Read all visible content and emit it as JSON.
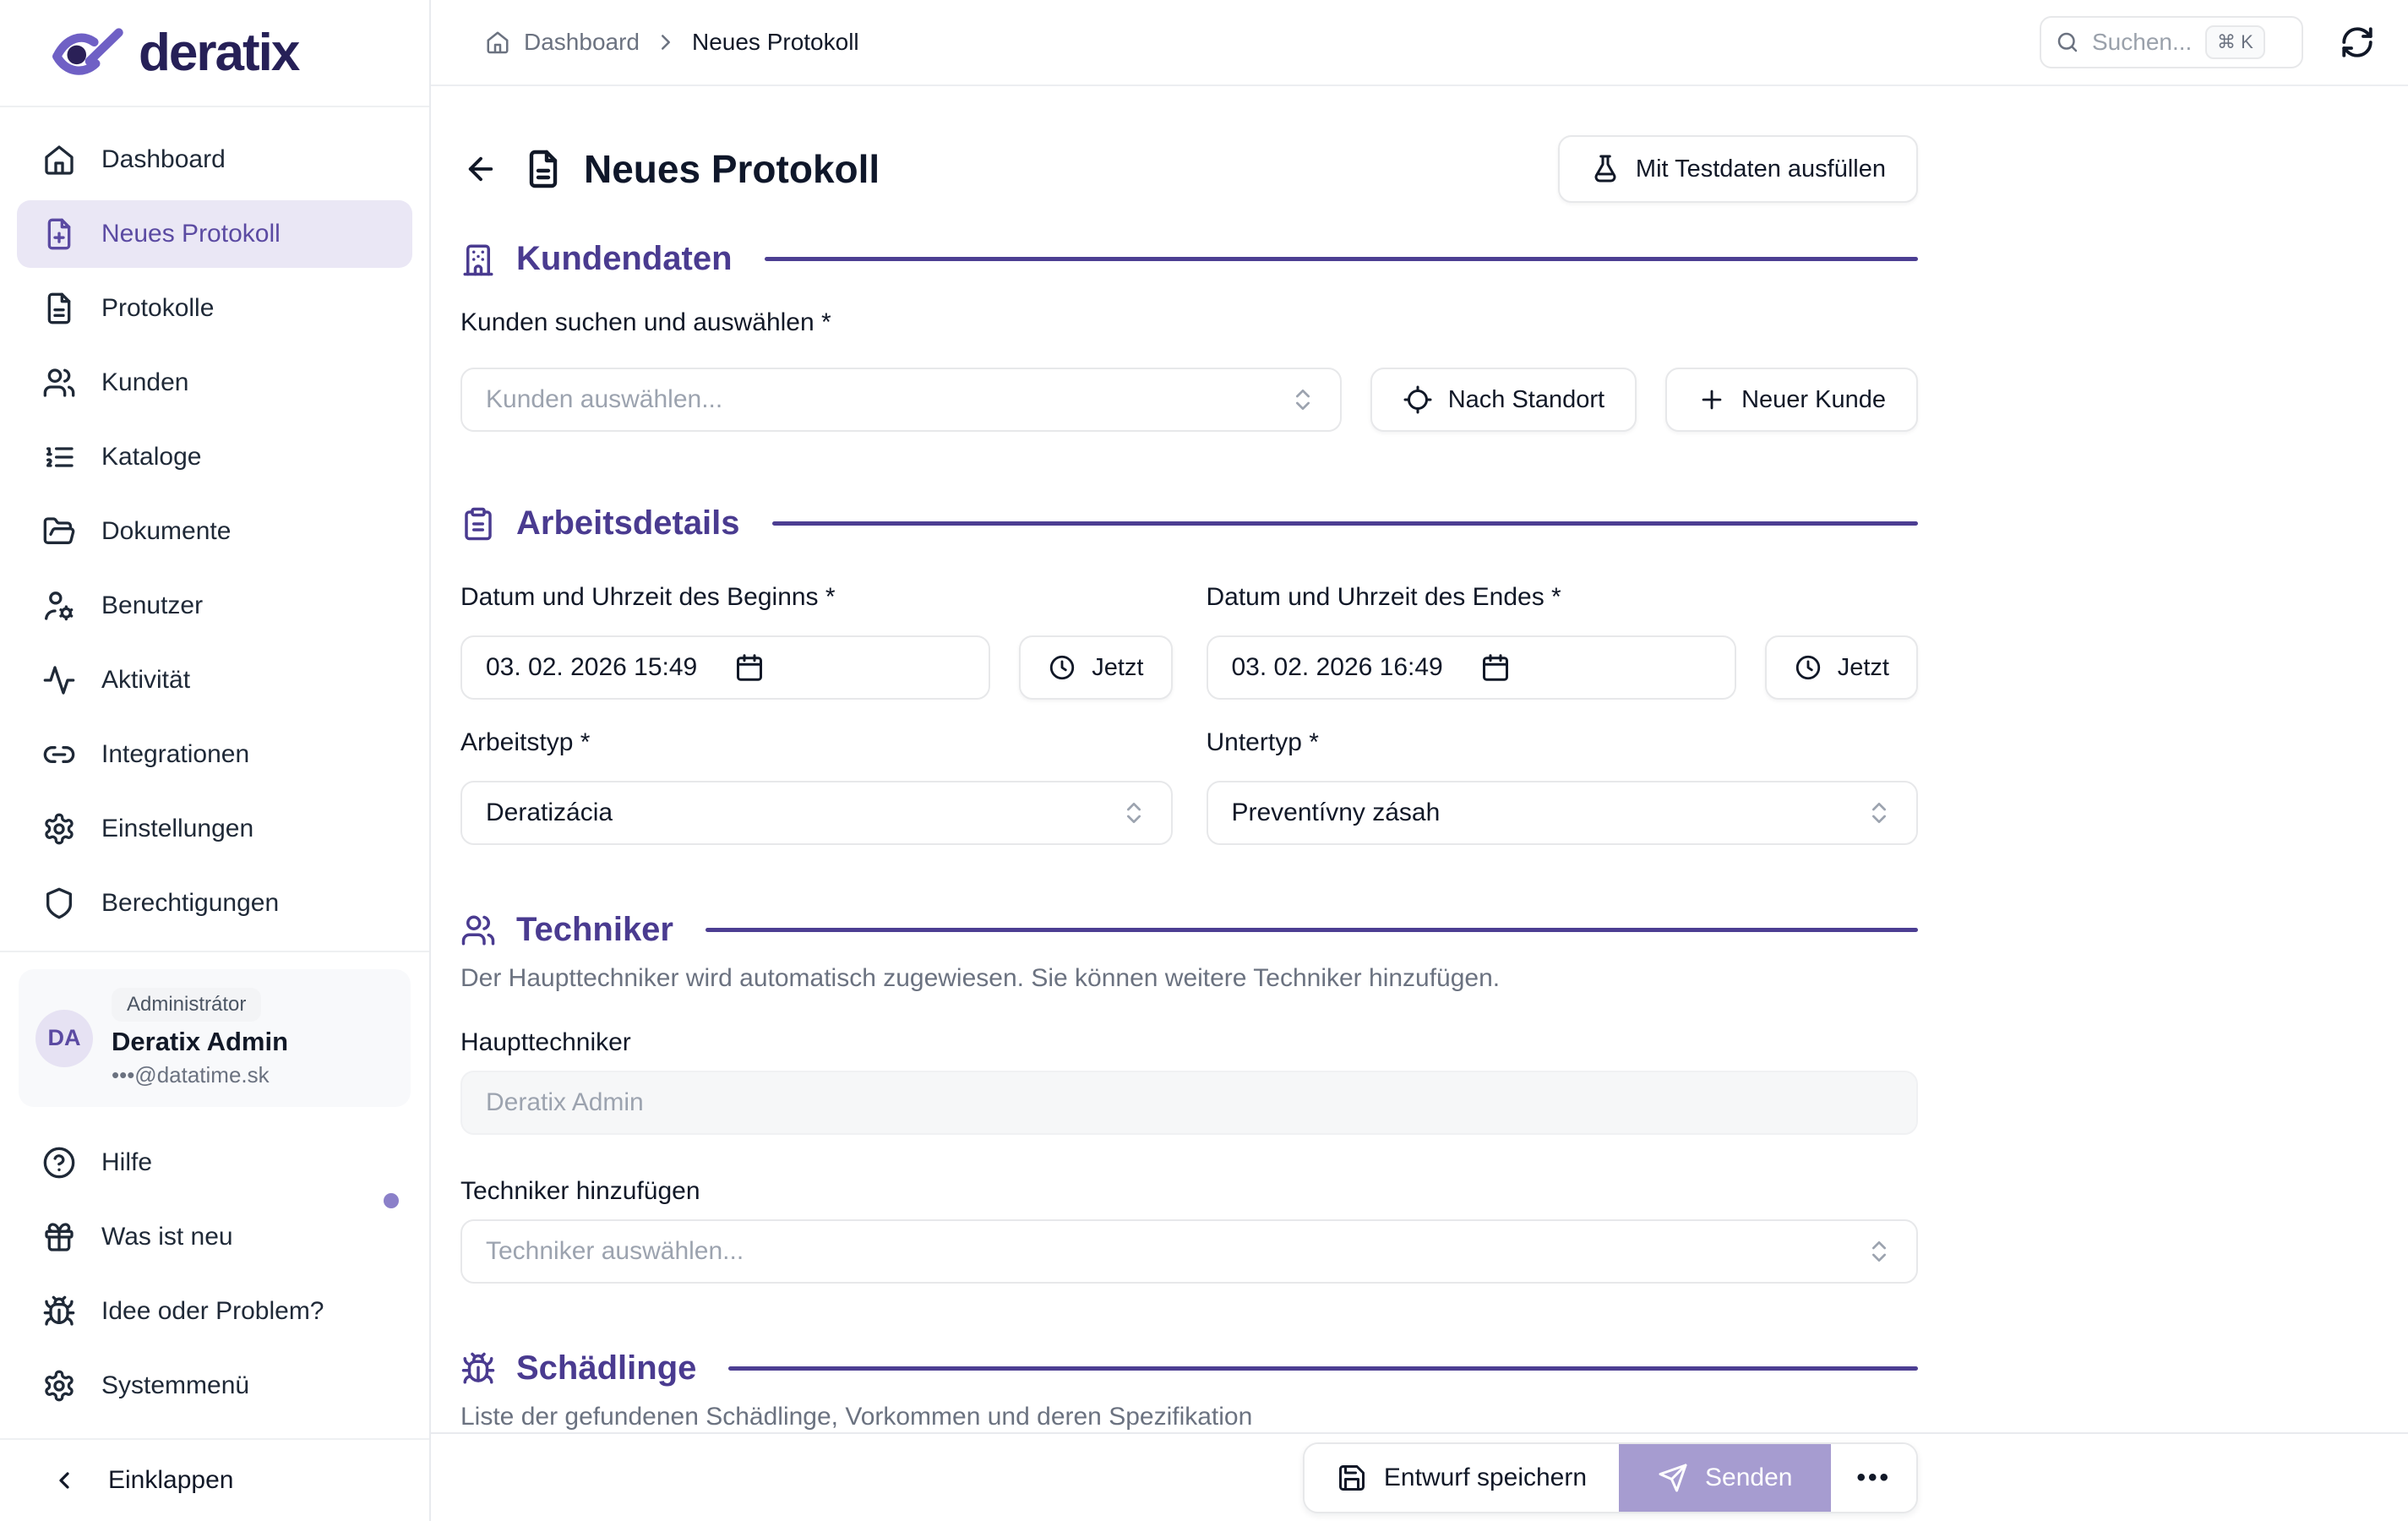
{
  "colors": {
    "accent_text": "#4a3b90",
    "accent_line": "#4c3e92",
    "active_item_bg": "#eae7f5",
    "active_item_text": "#5b4aa2",
    "send_button_bg": "#a69cd0",
    "notification_dot": "#8b80c9"
  },
  "brand": {
    "wordmark": "deratix",
    "logo_icon": "eye-logo-icon"
  },
  "sidebar": {
    "nav": [
      {
        "label": "Dashboard",
        "icon": "home-icon",
        "active": false
      },
      {
        "label": "Neues Protokoll",
        "icon": "file-plus-icon",
        "active": true
      },
      {
        "label": "Protokolle",
        "icon": "file-text-icon",
        "active": false
      },
      {
        "label": "Kunden",
        "icon": "users-icon",
        "active": false
      },
      {
        "label": "Kataloge",
        "icon": "list-ordered-icon",
        "active": false
      },
      {
        "label": "Dokumente",
        "icon": "folder-open-icon",
        "active": false
      },
      {
        "label": "Benutzer",
        "icon": "user-gear-icon",
        "active": false
      },
      {
        "label": "Aktivität",
        "icon": "activity-icon",
        "active": false
      },
      {
        "label": "Integrationen",
        "icon": "link-icon",
        "active": false
      },
      {
        "label": "Einstellungen",
        "icon": "gear-icon",
        "active": false
      },
      {
        "label": "Berechtigungen",
        "icon": "shield-icon",
        "active": false
      }
    ],
    "user": {
      "badge": "Administrátor",
      "initials": "DA",
      "name": "Deratix Admin",
      "email": "•••@datatime.sk"
    },
    "footer_nav": [
      {
        "label": "Hilfe",
        "icon": "help-circle-icon",
        "has_notification_dot": false
      },
      {
        "label": "Was ist neu",
        "icon": "gift-icon",
        "has_notification_dot": true
      },
      {
        "label": "Idee oder Problem?",
        "icon": "bug-icon",
        "has_notification_dot": false
      },
      {
        "label": "Systemmenü",
        "icon": "gear-icon",
        "has_notification_dot": false
      }
    ],
    "collapse": {
      "label": "Einklappen",
      "icon": "chevron-left-icon"
    }
  },
  "topbar": {
    "breadcrumb": {
      "home_icon": "home-icon",
      "items": [
        {
          "label": "Dashboard"
        },
        {
          "label": "Neues Protokoll"
        }
      ]
    },
    "search": {
      "placeholder": "Suchen...",
      "shortcut": "⌘ K",
      "icon": "search-icon"
    },
    "refresh_icon": "refresh-icon"
  },
  "page": {
    "back_icon": "arrow-left-icon",
    "title_icon": "file-text-icon",
    "title": "Neues Protokoll",
    "testdata_button": {
      "label": "Mit Testdaten ausfüllen",
      "icon": "flask-icon"
    }
  },
  "kundendaten": {
    "title": "Kundendaten",
    "icon": "building-icon",
    "search_label": "Kunden suchen und auswählen *",
    "select_placeholder": "Kunden auswählen...",
    "by_location_button": {
      "label": "Nach Standort",
      "icon": "locate-icon"
    },
    "new_customer_button": {
      "label": "Neuer Kunde",
      "icon": "plus-icon"
    }
  },
  "arbeitsdetails": {
    "title": "Arbeitsdetails",
    "icon": "clipboard-list-icon",
    "start_label": "Datum und Uhrzeit des Beginns *",
    "start_value": "03. 02. 2026 15:49",
    "end_label": "Datum und Uhrzeit des Endes *",
    "end_value": "03. 02. 2026 16:49",
    "now_button": {
      "label": "Jetzt",
      "icon": "clock-icon"
    },
    "worktype_label": "Arbeitstyp *",
    "worktype_value": "Deratizácia",
    "subtype_label": "Untertyp *",
    "subtype_value": "Preventívny zásah"
  },
  "techniker": {
    "title": "Techniker",
    "icon": "users-icon",
    "subtitle": "Der Haupttechniker wird automatisch zugewiesen. Sie können weitere Techniker hinzufügen.",
    "main_label": "Haupttechniker",
    "main_value": "Deratix Admin",
    "add_label": "Techniker hinzufügen",
    "add_placeholder": "Techniker auswählen..."
  },
  "schaedlinge": {
    "title": "Schädlinge",
    "icon": "bug-icon",
    "subtitle": "Liste der gefundenen Schädlinge, Vorkommen und deren Spezifikation"
  },
  "actionbar": {
    "save_draft": {
      "label": "Entwurf speichern",
      "icon": "save-icon"
    },
    "send": {
      "label": "Senden",
      "icon": "send-icon"
    },
    "more": "•••"
  }
}
